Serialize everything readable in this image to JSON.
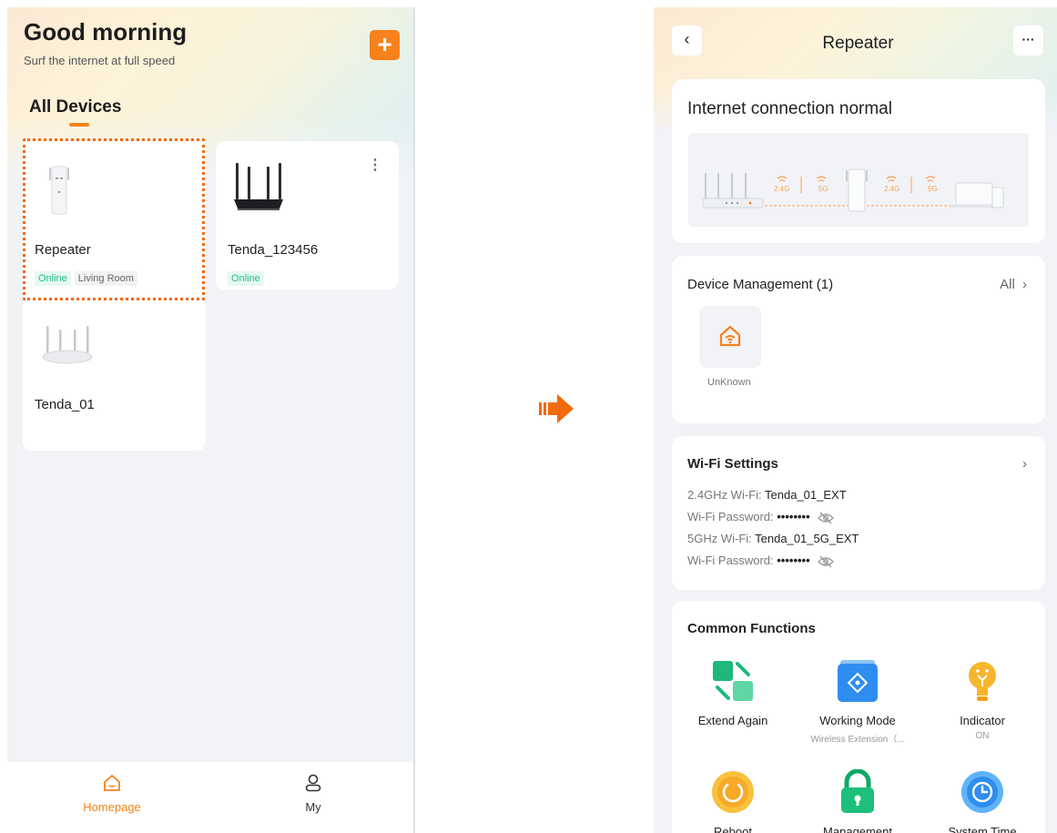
{
  "home": {
    "greeting": "Good morning",
    "subtitle": "Surf the internet at full speed",
    "add_button": "+",
    "section_title": "All Devices",
    "devices": [
      {
        "name": "Repeater",
        "tags": [
          "Online",
          "Living Room"
        ]
      },
      {
        "name": "Tenda_123456",
        "tags": [
          "Online"
        ]
      },
      {
        "name": "Tenda_01",
        "tags": []
      }
    ],
    "more_icon": "⋮",
    "tabs": [
      {
        "label": "Homepage",
        "icon": "home-icon",
        "active": true
      },
      {
        "label": "My",
        "icon": "user-icon",
        "active": false
      }
    ]
  },
  "detail": {
    "back_icon": "‹",
    "title": "Repeater",
    "more_icon": "···",
    "status": "Internet connection normal",
    "topology": {
      "bands": [
        "2.4G",
        "5G",
        "2.4G",
        "5G"
      ]
    },
    "device_mgmt": {
      "title": "Device Management (1)",
      "all_link": "All",
      "chevron": "›",
      "client_label": "UnKnown"
    },
    "wifi": {
      "title": "Wi-Fi Settings",
      "chevron": "›",
      "lines": [
        {
          "label": "2.4GHz Wi-Fi:",
          "value": "Tenda_01_EXT"
        },
        {
          "label": "Wi-Fi Password:",
          "value": "••••••••"
        },
        {
          "label": "5GHz Wi-Fi:",
          "value": "Tenda_01_5G_EXT"
        },
        {
          "label": "Wi-Fi Password:",
          "value": "••••••••"
        }
      ]
    },
    "functions": {
      "title": "Common Functions",
      "items": [
        {
          "label": "Extend Again",
          "sub": ""
        },
        {
          "label": "Working Mode",
          "sub": "Wireless Extension（..."
        },
        {
          "label": "Indicator",
          "sub": "ON"
        },
        {
          "label": "Reboot",
          "sub": ""
        },
        {
          "label": "Management",
          "sub": ""
        },
        {
          "label": "System Time",
          "sub": ""
        }
      ]
    }
  },
  "colors": {
    "accent": "#f7821b",
    "online": "#1fbf8c",
    "highlight_border": "#f26a0b"
  }
}
